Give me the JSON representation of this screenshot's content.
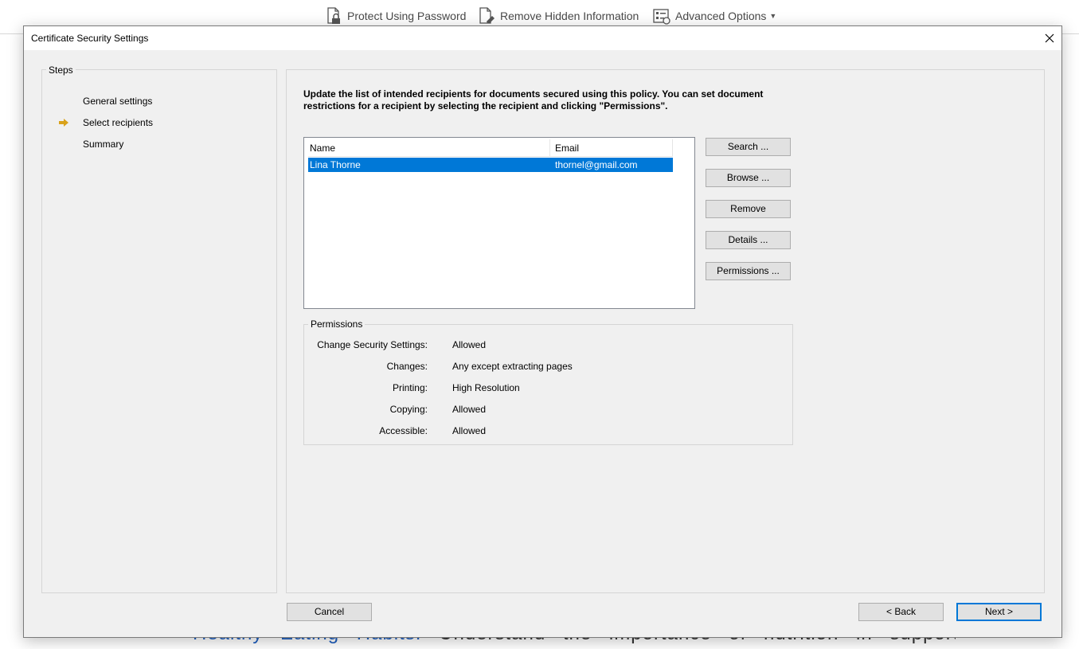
{
  "app_toolbar": {
    "protect_label": "Protect Using Password",
    "remove_hidden_label": "Remove Hidden Information",
    "advanced_label": "Advanced Options"
  },
  "document": {
    "bullet": "•",
    "link_text": "Healthy Eating Habits:",
    "body_text": "Understand the importance of nutrition in supporting your"
  },
  "dialog": {
    "title": "Certificate Security Settings",
    "steps": {
      "legend": "Steps",
      "items": [
        {
          "label": "General settings",
          "current": false
        },
        {
          "label": "Select recipients",
          "current": true
        },
        {
          "label": "Summary",
          "current": false
        }
      ]
    },
    "instructions": "Update the list of intended recipients for documents secured using this policy. You can set document restrictions for a recipient by selecting the recipient and clicking \"Permissions\".",
    "recipients": {
      "columns": [
        "Name",
        "Email"
      ],
      "rows": [
        {
          "name": "Lina Thorne",
          "email": "thornel@gmail.com",
          "selected": true
        }
      ]
    },
    "side_buttons": {
      "search": "Search ...",
      "browse": "Browse ...",
      "remove": "Remove",
      "details": "Details ...",
      "permissions": "Permissions ..."
    },
    "permissions": {
      "legend": "Permissions",
      "rows": [
        {
          "label": "Change Security Settings:",
          "value": "Allowed"
        },
        {
          "label": "Changes:",
          "value": "Any except extracting pages"
        },
        {
          "label": "Printing:",
          "value": "High Resolution"
        },
        {
          "label": "Copying:",
          "value": "Allowed"
        },
        {
          "label": "Accessible:",
          "value": "Allowed"
        }
      ]
    },
    "footer": {
      "cancel": "Cancel",
      "back": "< Back",
      "next": "Next >"
    },
    "colors": {
      "selection": "#0078d7",
      "step_arrow": "#d9a21b",
      "dialog_bg": "#f0f0f0"
    }
  }
}
